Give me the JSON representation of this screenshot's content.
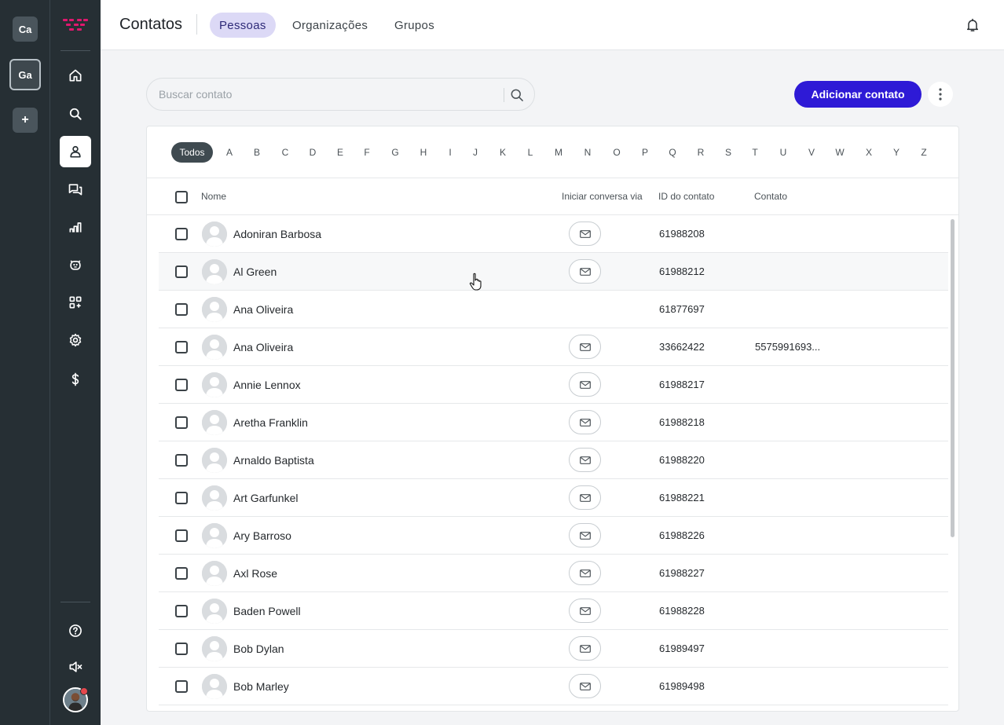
{
  "workspaces": [
    {
      "label": "Ca",
      "active": false
    },
    {
      "label": "Ga",
      "active": true
    },
    {
      "label": "+",
      "active": false
    }
  ],
  "nav": {
    "items": [
      {
        "icon": "home-icon",
        "active": false
      },
      {
        "icon": "search-icon",
        "active": false
      },
      {
        "icon": "contacts-icon",
        "active": true
      },
      {
        "icon": "chats-icon",
        "active": false
      },
      {
        "icon": "reports-icon",
        "active": false
      },
      {
        "icon": "bot-icon",
        "active": false
      },
      {
        "icon": "apps-icon",
        "active": false
      },
      {
        "icon": "settings-icon",
        "active": false
      },
      {
        "icon": "billing-icon",
        "active": false
      }
    ],
    "bottom": [
      {
        "icon": "help-icon"
      },
      {
        "icon": "sound-muted-icon"
      }
    ]
  },
  "header": {
    "title": "Contatos",
    "tabs": [
      {
        "label": "Pessoas",
        "active": true
      },
      {
        "label": "Organizações",
        "active": false
      },
      {
        "label": "Grupos",
        "active": false
      }
    ]
  },
  "search": {
    "placeholder": "Buscar contato",
    "value": ""
  },
  "add_button": "Adicionar contato",
  "alphabet": [
    "Todos",
    "A",
    "B",
    "C",
    "D",
    "E",
    "F",
    "G",
    "H",
    "I",
    "J",
    "K",
    "L",
    "M",
    "N",
    "O",
    "P",
    "Q",
    "R",
    "S",
    "T",
    "U",
    "V",
    "W",
    "X",
    "Y",
    "Z"
  ],
  "alphabet_selected": "Todos",
  "table": {
    "columns": {
      "name": "Nome",
      "channel": "Iniciar conversa via",
      "id": "ID do contato",
      "contact": "Contato"
    },
    "rows": [
      {
        "name": "Adoniran Barbosa",
        "has_email": true,
        "id": "61988208",
        "contact": ""
      },
      {
        "name": "Al Green",
        "has_email": true,
        "id": "61988212",
        "contact": ""
      },
      {
        "name": "Ana Oliveira",
        "has_email": false,
        "id": "61877697",
        "contact": ""
      },
      {
        "name": "Ana Oliveira",
        "has_email": true,
        "id": "33662422",
        "contact": "5575991693..."
      },
      {
        "name": "Annie Lennox",
        "has_email": true,
        "id": "61988217",
        "contact": ""
      },
      {
        "name": "Aretha Franklin",
        "has_email": true,
        "id": "61988218",
        "contact": ""
      },
      {
        "name": "Arnaldo Baptista",
        "has_email": true,
        "id": "61988220",
        "contact": ""
      },
      {
        "name": "Art Garfunkel",
        "has_email": true,
        "id": "61988221",
        "contact": ""
      },
      {
        "name": "Ary Barroso",
        "has_email": true,
        "id": "61988226",
        "contact": ""
      },
      {
        "name": "Axl Rose",
        "has_email": true,
        "id": "61988227",
        "contact": ""
      },
      {
        "name": "Baden Powell",
        "has_email": true,
        "id": "61988228",
        "contact": ""
      },
      {
        "name": "Bob Dylan",
        "has_email": true,
        "id": "61989497",
        "contact": ""
      },
      {
        "name": "Bob Marley",
        "has_email": true,
        "id": "61989498",
        "contact": ""
      }
    ],
    "hovered_row": 1
  },
  "colors": {
    "sidebar": "#262f34",
    "accent": "#2e1ad6",
    "active_tab_bg": "#dcd9f6",
    "brand_logo": "#e0186e"
  }
}
